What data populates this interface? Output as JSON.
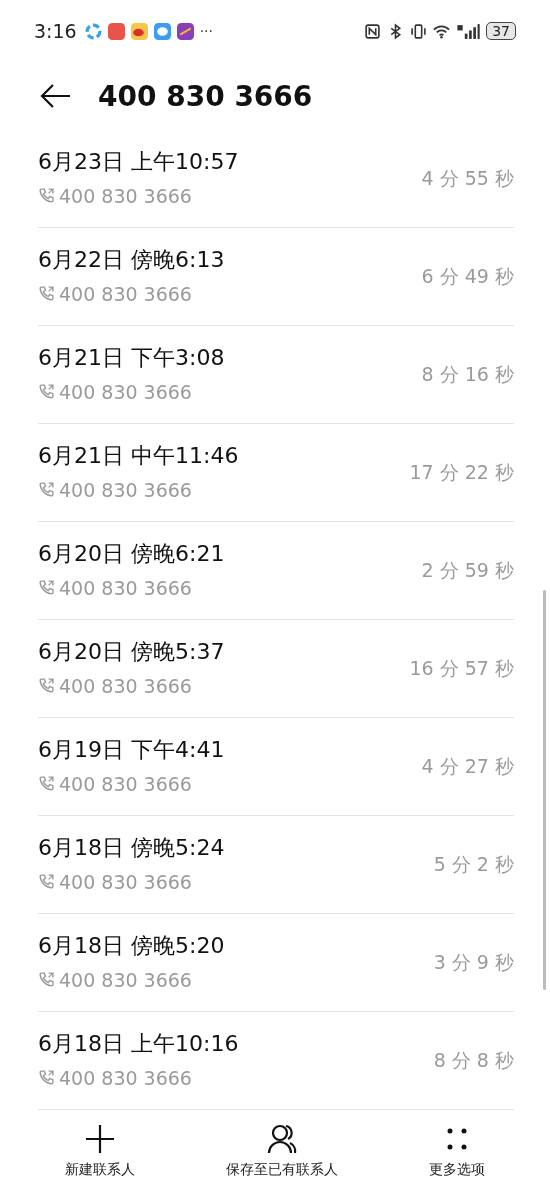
{
  "status_bar": {
    "time": "3:16",
    "more": "···",
    "battery": "37"
  },
  "header": {
    "title": "400 830 3666"
  },
  "calls": [
    {
      "date": "6月23日 上午10:57",
      "number": "400 830 3666",
      "duration": "4 分 55 秒"
    },
    {
      "date": "6月22日 傍晚6:13",
      "number": "400 830 3666",
      "duration": "6 分 49 秒"
    },
    {
      "date": "6月21日 下午3:08",
      "number": "400 830 3666",
      "duration": "8 分 16 秒"
    },
    {
      "date": "6月21日 中午11:46",
      "number": "400 830 3666",
      "duration": "17 分 22 秒"
    },
    {
      "date": "6月20日 傍晚6:21",
      "number": "400 830 3666",
      "duration": "2 分 59 秒"
    },
    {
      "date": "6月20日 傍晚5:37",
      "number": "400 830 3666",
      "duration": "16 分 57 秒"
    },
    {
      "date": "6月19日 下午4:41",
      "number": "400 830 3666",
      "duration": "4 分 27 秒"
    },
    {
      "date": "6月18日 傍晚5:24",
      "number": "400 830 3666",
      "duration": "5 分 2 秒"
    },
    {
      "date": "6月18日 傍晚5:20",
      "number": "400 830 3666",
      "duration": "3 分 9 秒"
    },
    {
      "date": "6月18日 上午10:16",
      "number": "400 830 3666",
      "duration": "8 分 8 秒"
    }
  ],
  "actions": [
    {
      "kind": "add",
      "label": "新建联系人"
    },
    {
      "kind": "person",
      "label": "保存至已有联系人"
    },
    {
      "kind": "more",
      "label": "更多选项"
    }
  ]
}
